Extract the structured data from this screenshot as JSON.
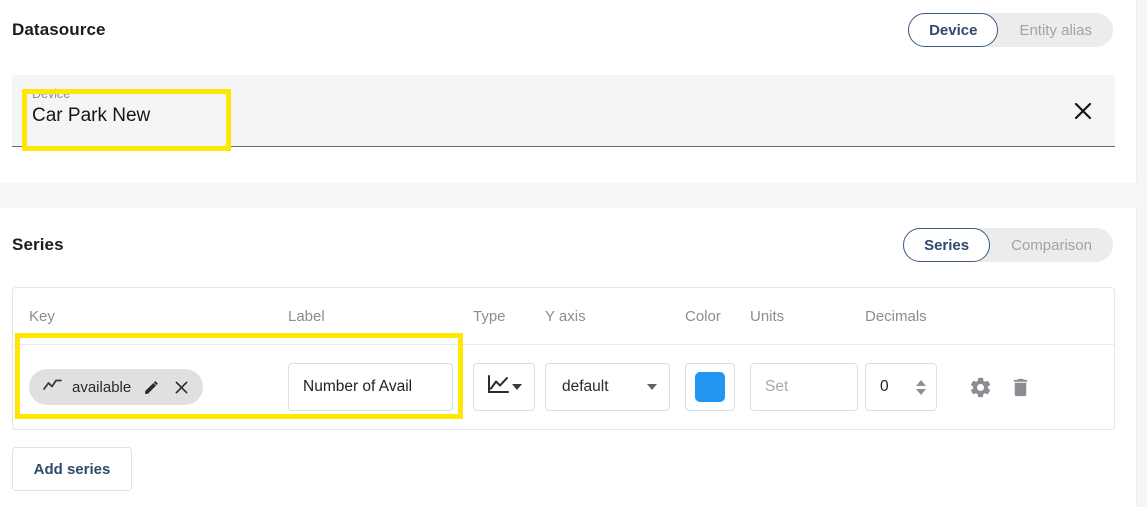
{
  "datasource": {
    "title": "Datasource",
    "toggle": {
      "selected": "Device",
      "options": [
        "Device",
        "Entity alias"
      ],
      "option_device": "Device",
      "option_entity_alias": "Entity alias"
    },
    "field": {
      "label": "Device*",
      "value": "Car Park New",
      "clear_icon": "close-icon"
    }
  },
  "series": {
    "title": "Series",
    "toggle": {
      "selected": "Series",
      "options": [
        "Series",
        "Comparison"
      ],
      "option_series": "Series",
      "option_comparison": "Comparison"
    },
    "columns": {
      "key": "Key",
      "label": "Label",
      "type": "Type",
      "yaxis": "Y axis",
      "color": "Color",
      "units": "Units",
      "decimals": "Decimals"
    },
    "rows": [
      {
        "key": "available",
        "key_icon": "timeseries-icon",
        "edit_icon": "pencil-icon",
        "remove_icon": "close-icon",
        "label": "Number of Avail",
        "type_icon": "line-chart-icon",
        "yaxis": "default",
        "color": "#2196F3",
        "units_placeholder": "Set",
        "units_value": "",
        "decimals": "0",
        "settings_icon": "gear-icon",
        "delete_icon": "trash-icon"
      }
    ],
    "add_button": "Add series"
  }
}
